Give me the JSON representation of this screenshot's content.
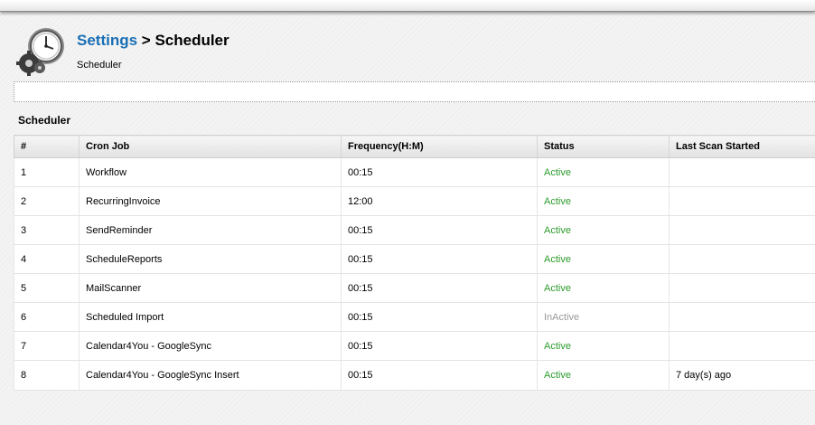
{
  "header": {
    "breadcrumb_link": "Settings",
    "breadcrumb_sep": " > ",
    "breadcrumb_current": "Scheduler",
    "subtitle": "Scheduler"
  },
  "section": {
    "title": "Scheduler"
  },
  "table": {
    "columns": [
      "#",
      "Cron Job",
      "Frequency(H:M)",
      "Status",
      "Last Scan Started"
    ],
    "rows": [
      {
        "num": "1",
        "job": "Workflow",
        "freq": "00:15",
        "status": "Active",
        "last": ""
      },
      {
        "num": "2",
        "job": "RecurringInvoice",
        "freq": "12:00",
        "status": "Active",
        "last": ""
      },
      {
        "num": "3",
        "job": "SendReminder",
        "freq": "00:15",
        "status": "Active",
        "last": ""
      },
      {
        "num": "4",
        "job": "ScheduleReports",
        "freq": "00:15",
        "status": "Active",
        "last": ""
      },
      {
        "num": "5",
        "job": "MailScanner",
        "freq": "00:15",
        "status": "Active",
        "last": ""
      },
      {
        "num": "6",
        "job": "Scheduled Import",
        "freq": "00:15",
        "status": "InActive",
        "last": ""
      },
      {
        "num": "7",
        "job": "Calendar4You - GoogleSync",
        "freq": "00:15",
        "status": "Active",
        "last": ""
      },
      {
        "num": "8",
        "job": "Calendar4You - GoogleSync Insert",
        "freq": "00:15",
        "status": "Active",
        "last": "7 day(s) ago"
      }
    ]
  },
  "colors": {
    "link": "#1a6fb5",
    "active": "#2d9b2d",
    "inactive": "#9a9a9a"
  },
  "icons": {
    "header": "clock-gears-icon"
  }
}
